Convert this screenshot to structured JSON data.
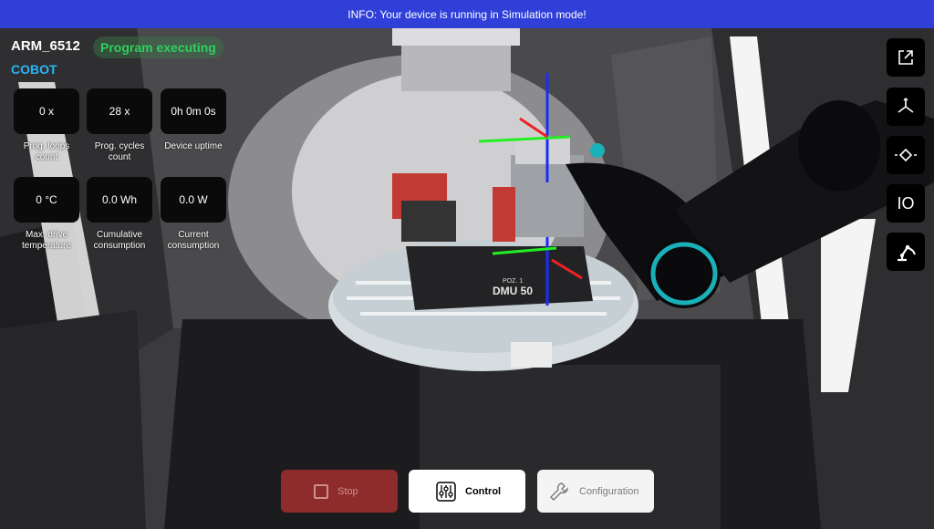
{
  "banner": {
    "text": "INFO: Your device is running in Simulation mode!"
  },
  "device": {
    "name": "ARM_6512",
    "type": "COBOT",
    "status": "Program executing"
  },
  "stats": [
    {
      "value": "0 x",
      "label_line1": "Prog. loops",
      "label_line2": "count"
    },
    {
      "value": "28 x",
      "label_line1": "Prog. cycles",
      "label_line2": "count"
    },
    {
      "value": "0h 0m 0s",
      "label_line1": "Device uptime",
      "label_line2": ""
    },
    {
      "value": "0 °C",
      "label_line1": "Max. drive",
      "label_line2": "temperature"
    },
    {
      "value": "0.0 Wh",
      "label_line1": "Cumulative",
      "label_line2": "consumption"
    },
    {
      "value": "0.0 W",
      "label_line1": "Current",
      "label_line2": "consumption"
    }
  ],
  "scene": {
    "label_top": "POZ. 1",
    "label_main": "DMU 50"
  },
  "side_toolbar": [
    {
      "icon": "external-link-icon"
    },
    {
      "icon": "axes-icon"
    },
    {
      "icon": "waypoint-icon"
    },
    {
      "icon": "io-icon"
    },
    {
      "icon": "robot-arm-icon"
    }
  ],
  "io_label": "IO",
  "bottom": {
    "stop": "Stop",
    "control": "Control",
    "configuration": "Configuration"
  },
  "colors": {
    "banner": "#2f3fd8",
    "status": "#2fd060",
    "cobot": "#28b6f6",
    "stop_bg": "#8e2b2b",
    "accent_teal": "#1ab0b8"
  }
}
